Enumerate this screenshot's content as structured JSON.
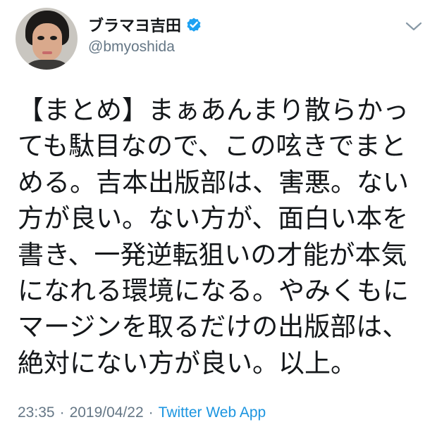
{
  "user": {
    "name": "ブラマヨ吉田",
    "handle": "@bmyoshida",
    "verified": true
  },
  "icons": {
    "verified": "verified-badge-icon",
    "menu": "chevron-down-icon"
  },
  "tweet": {
    "lines": [
      "【まとめ】まぁあんまり散らかっ",
      "ても駄目なので、この呟きでまと",
      "める。吉本出版部は、害悪。ない",
      "方が良い。ない方が、面白い本を",
      "書き、一発逆転狙いの才能が本気",
      "になれる環境になる。やみくもに",
      "マージンを取るだけの出版部は、",
      "絶対にない方が良い。以上。"
    ]
  },
  "meta": {
    "time": "23:35",
    "separator": "·",
    "date": "2019/04/22",
    "source": "Twitter Web App"
  },
  "colors": {
    "text": "#14171a",
    "secondary": "#657786",
    "link": "#1b95e0",
    "verified": "#1da1f2"
  }
}
